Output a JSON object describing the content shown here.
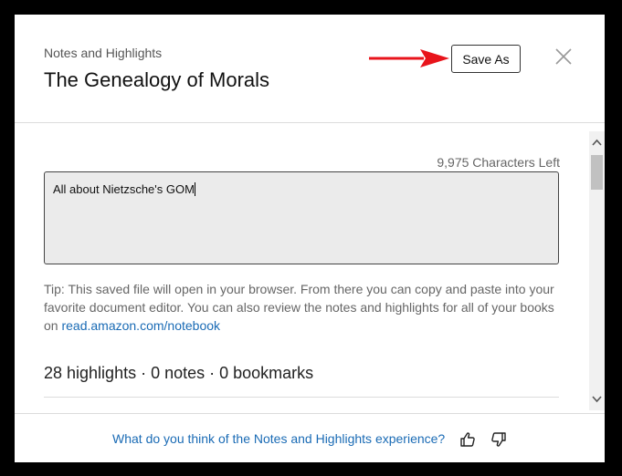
{
  "header": {
    "subtitle": "Notes and Highlights",
    "title": "The Genealogy of Morals",
    "save_label": "Save As",
    "close_icon": "close-icon"
  },
  "editor": {
    "chars_left": "9,975 Characters Left",
    "note_text": "All about Nietzsche's GOM"
  },
  "tip": {
    "text": "Tip: This saved file will open in your browser. From there you can copy and paste into your favorite document editor. You can also review the notes and highlights for all of your books on ",
    "link": "read.amazon.com/notebook"
  },
  "summary": {
    "counts": "28 highlights · 0 notes · 0 bookmarks"
  },
  "footer": {
    "feedback_question": "What do you think of the Notes and Highlights experience?",
    "thumbs_up_icon": "thumbs-up-icon",
    "thumbs_down_icon": "thumbs-down-icon"
  },
  "colors": {
    "link": "#1a6bb5",
    "annotation_arrow": "#e8141b",
    "textarea_bg": "#ebebeb"
  }
}
